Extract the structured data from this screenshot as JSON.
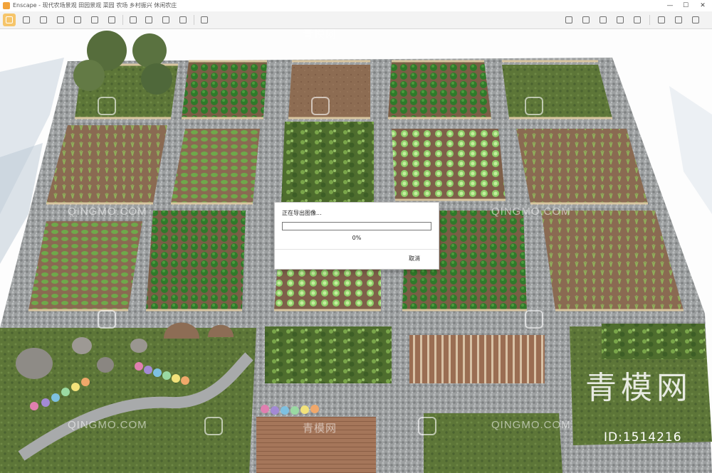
{
  "window": {
    "title": "Enscape - 现代农场景观 田园景观 菜园 农场 乡村振兴 休闲农庄",
    "controls": {
      "minimize": "—",
      "maximize": "☐",
      "close": "✕"
    }
  },
  "toolbar": {
    "left_icons": [
      "cursor-icon",
      "pencil-icon",
      "walk-icon",
      "camera-icon",
      "save-icon",
      "bookmark-icon",
      "atom-icon",
      "view-icon",
      "grid-icon",
      "capture-icon",
      "panorama-icon",
      "video-icon",
      "monitor-icon",
      "settings-icon"
    ],
    "right_icons": [
      "asset-library-icon",
      "screenshot-icon",
      "cube-icon",
      "export-icon",
      "link-icon",
      "eye-icon",
      "gear-icon",
      "help-icon"
    ]
  },
  "watermarks": {
    "site": "QINGMO.COM",
    "chinese_site": "青模网",
    "brand": "青模网",
    "id_label": "ID:1514216"
  },
  "dialog": {
    "message": "正在导出图像...",
    "progress_percent": 0,
    "progress_text": "0%",
    "cancel_label": "取消",
    "progress_color": "#06b025"
  },
  "colors": {
    "path_stone": "#9a9d9e",
    "soil": "#8a6a52",
    "grass": "#5f7a3a",
    "fence": "#c9b48c",
    "crop_green": "#2f7a2a",
    "cabbage": "#8fd06a"
  }
}
